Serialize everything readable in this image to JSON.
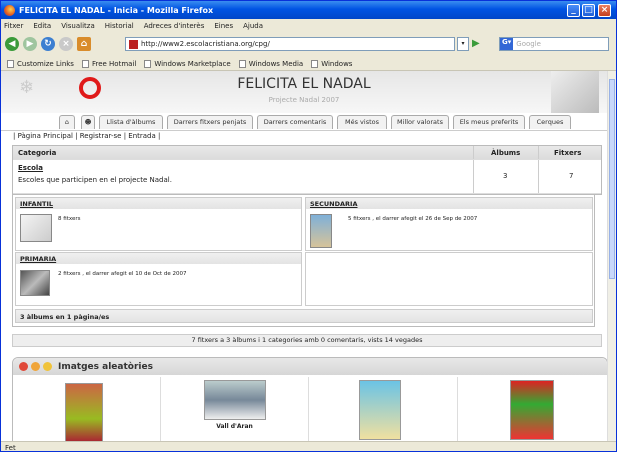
{
  "window": {
    "title": "FELICITA EL NADAL - Inicia - Mozilla Firefox"
  },
  "menu": [
    "Fitxer",
    "Edita",
    "Visualitza",
    "Historial",
    "Adreces d'interès",
    "Eines",
    "Ajuda"
  ],
  "nav": {
    "url": "http://www2.escolacristiana.org/cpg/",
    "search_placeholder": "Google"
  },
  "bookmarks": [
    "Customize Links",
    "Free Hotmail",
    "Windows Marketplace",
    "Windows Media",
    "Windows"
  ],
  "site": {
    "title": "FELICITA EL NADAL",
    "subtitle": "Projecte Nadal 2007"
  },
  "tabs": [
    "Llista d'àlbums",
    "Darrers fitxers penjats",
    "Darrers comentaris",
    "Més vistos",
    "Millor valorats",
    "Els meus preferits",
    "Cerques"
  ],
  "quicklinks": "| Pàgina Principal | Registrar-se | Entrada |",
  "table": {
    "headers": {
      "category": "Categoria",
      "albums": "Àlbums",
      "files": "Fitxers"
    },
    "category": {
      "name": "Escola",
      "desc": "Escoles que participen en el projecte Nadal.",
      "albums": "3",
      "files": "7"
    }
  },
  "albums": [
    {
      "name": "INFANTIL",
      "info": "8 fitxers"
    },
    {
      "name": "SECUNDARIA",
      "info": "5 fitxers , el darrer afegit el 26 de Sep de 2007"
    },
    {
      "name": "PRIMARIA",
      "info": "2 fitxers , el darrer afegit el 10 de Oct de 2007"
    }
  ],
  "albums_footer": "3 àlbums en 1 pàgina/es",
  "stats": "7 fitxers a 3 àlbums i 1 categories amb 0 comentaris, vists 14 vegades",
  "random": {
    "title": "Imatges aleatòries",
    "caption": "Vall d'Aran"
  },
  "status": "Fet"
}
